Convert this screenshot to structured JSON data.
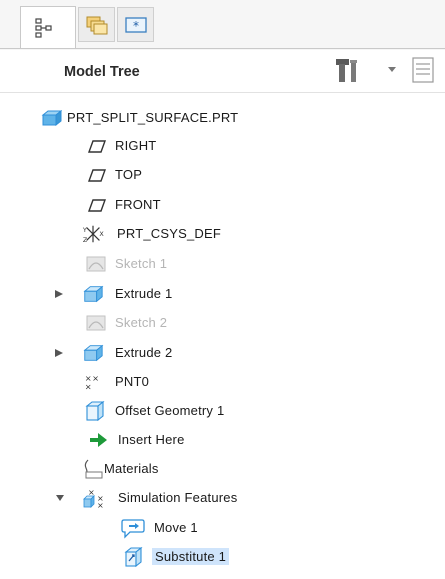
{
  "header": {
    "title": "Model Tree"
  },
  "tree": {
    "root": {
      "label": "PRT_SPLIT_SURFACE.PRT"
    },
    "items": [
      {
        "label": "RIGHT",
        "icon": "datum-plane-icon"
      },
      {
        "label": "TOP",
        "icon": "datum-plane-icon"
      },
      {
        "label": "FRONT",
        "icon": "datum-plane-icon"
      },
      {
        "label": "PRT_CSYS_DEF",
        "icon": "coordinate-system-icon"
      },
      {
        "label": "Sketch 1",
        "icon": "sketch-icon",
        "dimmed": true
      },
      {
        "label": "Extrude 1",
        "icon": "extrude-icon",
        "expandable": true
      },
      {
        "label": "Sketch 2",
        "icon": "sketch-icon",
        "dimmed": true
      },
      {
        "label": "Extrude 2",
        "icon": "extrude-icon",
        "expandable": true
      },
      {
        "label": "PNT0",
        "icon": "datum-point-icon"
      },
      {
        "label": "Offset Geometry 1",
        "icon": "offset-geometry-icon"
      },
      {
        "label": "Insert Here",
        "icon": "insert-arrow-icon"
      },
      {
        "label": "Materials",
        "icon": "materials-icon"
      },
      {
        "label": "Simulation Features",
        "icon": "simulation-features-icon",
        "expanded": true
      },
      {
        "label": "Move 1",
        "icon": "move-icon"
      },
      {
        "label": "Substitute 1",
        "icon": "substitute-icon",
        "selected": true
      }
    ]
  },
  "colors": {
    "accent": "#2f8fd8",
    "selection": "#cfe4fb",
    "dimmed_text": "#b5b5b5"
  }
}
